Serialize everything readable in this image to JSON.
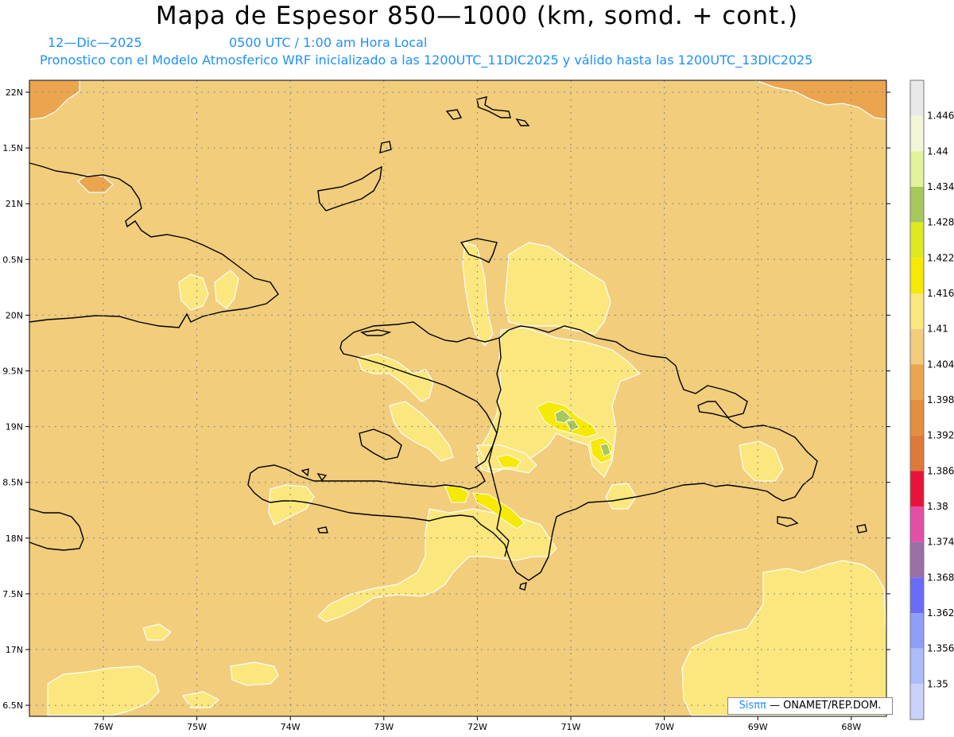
{
  "header": {
    "title": "Mapa de Espesor 850—1000 (km, somd. + cont.)",
    "date": "12—Dic—2025",
    "time": "0500 UTC / 1:00 am Hora Local",
    "model_line": "Pronostico con el Modelo Atmosferico WRF inicializado a las 1200UTC_11DIC2025 y válido hasta las  1200UTC_13DIC2025"
  },
  "axes": {
    "lat_labels": [
      "22N",
      "1.5N",
      "21N",
      "0.5N",
      "20N",
      "9.5N",
      "19N",
      "8.5N",
      "18N",
      "7.5N",
      "17N",
      "6.5N"
    ],
    "lon_labels": [
      "76W",
      "75W",
      "74W",
      "73W",
      "72W",
      "71W",
      "70W",
      "69W",
      "68W"
    ]
  },
  "colorbar": {
    "labels": [
      "1.446",
      "1.44",
      "1.434",
      "1.428",
      "1.422",
      "1.416",
      "1.41",
      "1.404",
      "1.398",
      "1.392",
      "1.386",
      "1.38",
      "1.374",
      "1.368",
      "1.362",
      "1.356",
      "1.35"
    ],
    "colors": [
      "#e9e9e9",
      "#f2f6d7",
      "#e3f39b",
      "#a6c85d",
      "#dfea1e",
      "#f6e904",
      "#fbe77d",
      "#f1cd7c",
      "#eba54e",
      "#e58e3b",
      "#de7a38",
      "#e8133a",
      "#e44ea7",
      "#9a6fa8",
      "#6a6cf7",
      "#8f9ff9",
      "#aebcfb",
      "#c9d2fc"
    ]
  },
  "credit": {
    "brand": "Sisππ",
    "org": " — ONAMET/REP.DOM."
  },
  "map_colors": {
    "ocean": "#f1cd7c",
    "light": "#fbe77d",
    "warm": "#eba54e",
    "yellow": "#f6e904",
    "green": "#a6c85d",
    "coast": "#000000"
  }
}
